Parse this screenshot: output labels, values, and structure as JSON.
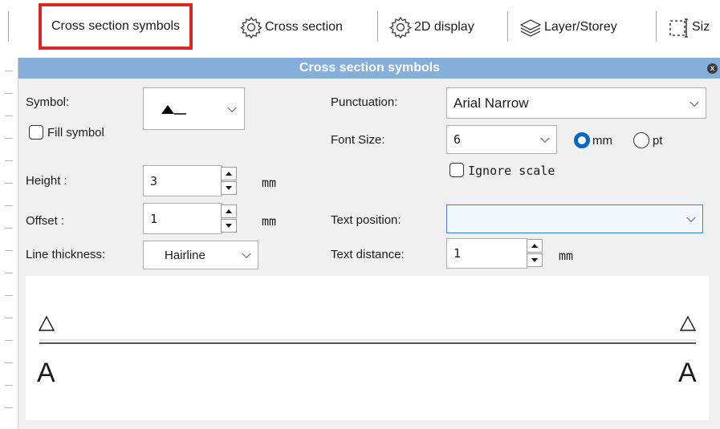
{
  "toolbar": {
    "items": [
      {
        "label": "Cross section symbols",
        "icon": "none"
      },
      {
        "label": "Cross section",
        "icon": "gear-icon"
      },
      {
        "label": "2D display",
        "icon": "gear-icon"
      },
      {
        "label": "Layer/Storey",
        "icon": "layers-icon"
      },
      {
        "label": "Siz",
        "icon": "resize-icon"
      }
    ],
    "active_color": "#d9262a"
  },
  "dialog": {
    "title": "Cross section symbols",
    "title_color": "#85aedb",
    "close_label": "x",
    "symbol": {
      "label": "Symbol:",
      "fill_label": "Fill symbol",
      "fill_checked": false
    },
    "height": {
      "label": "Height :",
      "value": "3",
      "unit": "mm"
    },
    "offset": {
      "label": "Offset :",
      "value": "1",
      "unit": "mm"
    },
    "line_thickness": {
      "label": "Line thickness:",
      "value": "Hairline"
    },
    "punctuation": {
      "label": "Punctuation:",
      "value": "Arial Narrow"
    },
    "font_size": {
      "label": "Font Size:",
      "value": "6",
      "unit_mm": "mm",
      "unit_pt": "pt",
      "selected_unit": "mm"
    },
    "ignore_scale": {
      "label": "Ignore scale",
      "checked": false
    },
    "text_position": {
      "label": "Text position:",
      "value": ""
    },
    "text_distance": {
      "label": "Text distance:",
      "value": "1",
      "unit": "mm"
    },
    "preview": {
      "left_letter": "A",
      "right_letter": "A"
    }
  }
}
